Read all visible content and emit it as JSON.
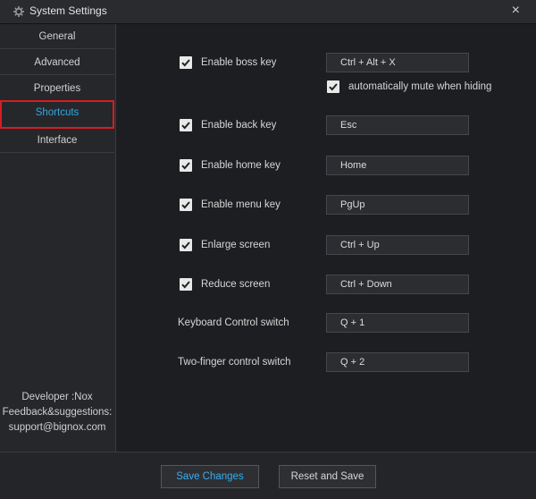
{
  "window": {
    "title": "System Settings",
    "close_symbol": "×"
  },
  "sidebar": {
    "items": [
      {
        "label": "General",
        "active": false
      },
      {
        "label": "Advanced",
        "active": false
      },
      {
        "label": "Properties",
        "active": false
      },
      {
        "label": "Shortcuts",
        "active": true
      },
      {
        "label": "Interface",
        "active": false
      }
    ],
    "developer": "Developer :Nox",
    "feedback": "Feedback&suggestions:",
    "email": "support@bignox.com"
  },
  "shortcuts": {
    "boss_key": {
      "label": "Enable boss key",
      "checked": true,
      "value": "Ctrl + Alt + X"
    },
    "mute": {
      "label": "automatically mute when hiding",
      "checked": true
    },
    "back_key": {
      "label": "Enable back key",
      "checked": true,
      "value": "Esc"
    },
    "home_key": {
      "label": "Enable home key",
      "checked": true,
      "value": "Home"
    },
    "menu_key": {
      "label": "Enable menu key",
      "checked": true,
      "value": "PgUp"
    },
    "enlarge": {
      "label": "Enlarge screen",
      "checked": true,
      "value": "Ctrl + Up"
    },
    "reduce": {
      "label": "Reduce screen",
      "checked": true,
      "value": "Ctrl + Down"
    },
    "keyboard_switch": {
      "label": "Keyboard Control switch",
      "value": "Q + 1"
    },
    "two_finger": {
      "label": "Two-finger control switch",
      "value": "Q + 2"
    }
  },
  "footer": {
    "save_label": "Save Changes",
    "reset_label": "Reset and Save"
  },
  "colors": {
    "accent": "#2fa8e6",
    "highlight_border": "#d51e22",
    "background": "#1d1e21"
  }
}
